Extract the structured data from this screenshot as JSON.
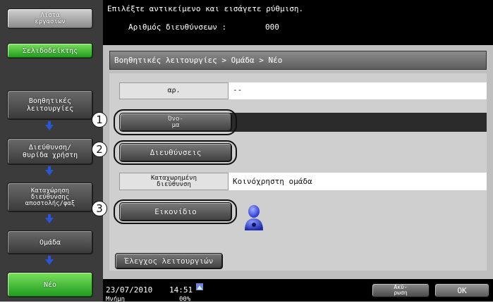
{
  "sidebar": {
    "job_list": "Λίστα\nεργασιών",
    "bookmark": "Σελιδοδείκτης",
    "items": [
      {
        "label": "Βοηθητικές\nλειτουργίες"
      },
      {
        "label": "Διεύθυνση/\nθυρίδα χρήστη"
      },
      {
        "label": "Καταχώρηση\nδιεύθυνσης\nαποστολής/φαξ"
      },
      {
        "label": "Ομάδα"
      },
      {
        "label": "Νέο"
      }
    ]
  },
  "top": {
    "message": "Επιλέξτε αντικείμενο και εισάγετε ρύθμιση.",
    "count_label": "Αριθμός διευθύνσεων :",
    "count_value": "000"
  },
  "panel": {
    "breadcrumb": "Βοηθητικές λειτουργίες > Ομάδα > Νέο",
    "no_label": "αρ.",
    "no_value": "--",
    "name_button": "Όνο-\nμα",
    "name_value": "",
    "addresses_button": "Διευθύνσεις",
    "registered_label": "Καταχωρημένη\nδιεύθυνση",
    "registered_value": "Κοινόχρηστη ομάδα",
    "icon_button": "Εικονίδιο",
    "check_button": "Έλεγχος λειτουργιών"
  },
  "callouts": [
    "1",
    "2",
    "3"
  ],
  "bottom": {
    "date": "23/07/2010",
    "time": "14:51",
    "memory_label": "Μνήμη",
    "memory_value": "00%",
    "cancel_button": "Ακύ-\nρωση",
    "ok_button": "OK"
  },
  "colors": {
    "accent_green": "#1f9a1f",
    "arrow_blue": "#2a55d8",
    "avatar_blue": "#2e3fd6"
  }
}
